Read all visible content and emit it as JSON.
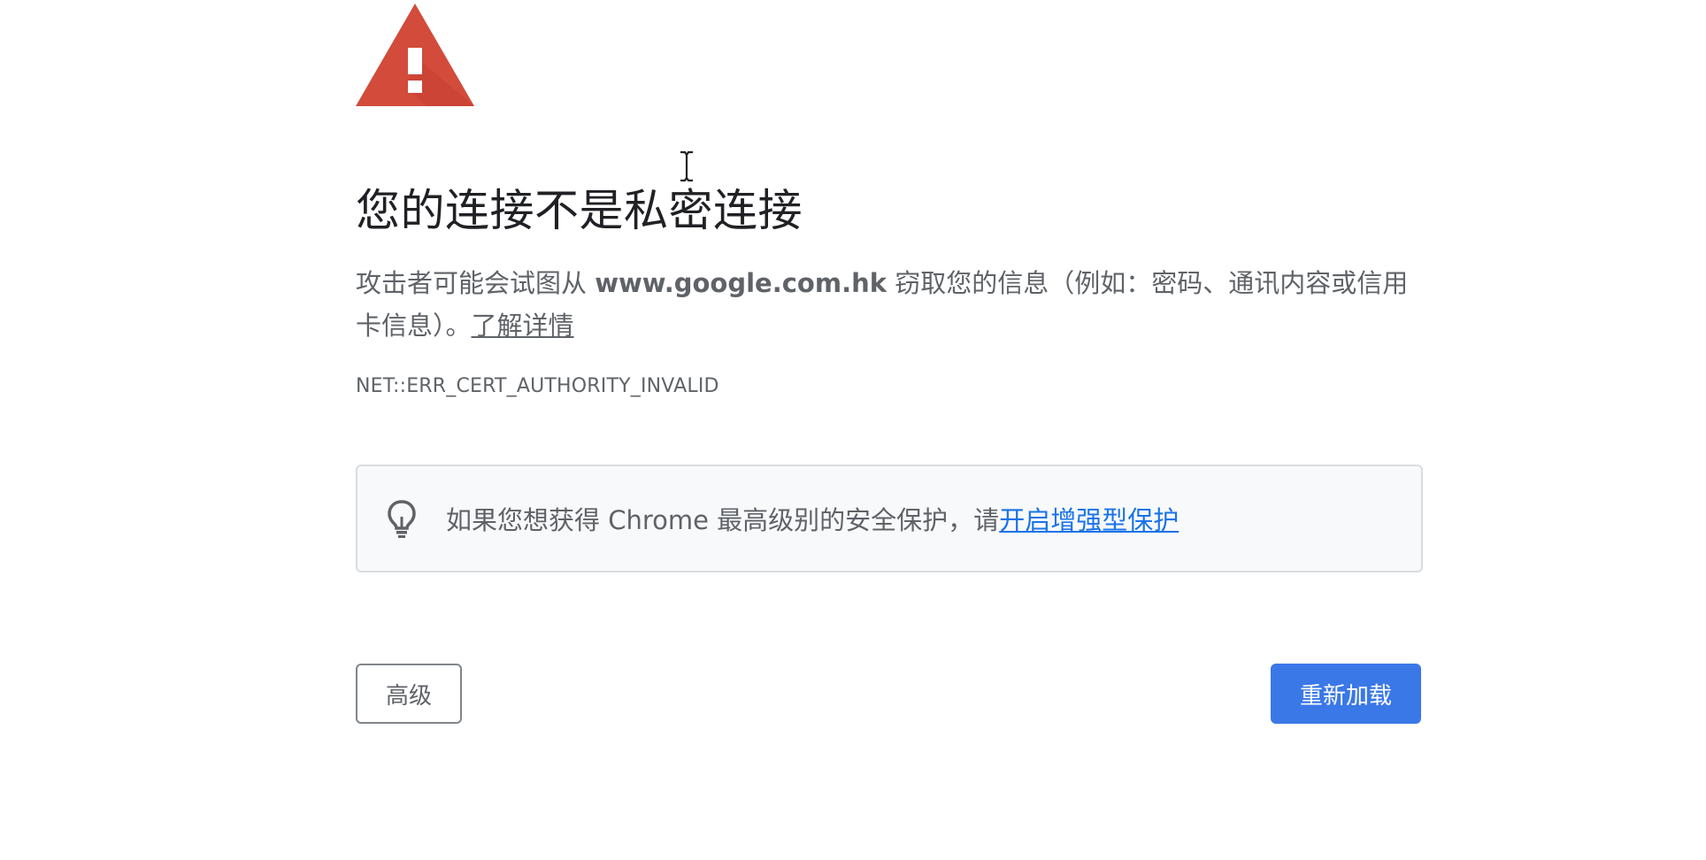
{
  "interstitial": {
    "title": "您的连接不是私密连接",
    "explanation_prefix": "攻击者可能会试图从 ",
    "domain": "www.google.com.hk",
    "explanation_suffix": " 窃取您的信息（例如：密码、通讯内容或信用卡信息）。",
    "learn_more_label": "了解详情",
    "error_code": "NET::ERR_CERT_AUTHORITY_INVALID"
  },
  "promo": {
    "icon": "lightbulb-icon",
    "text": "如果您想获得 Chrome 最高级别的安全保护，请",
    "link_label": "开启增强型保护"
  },
  "buttons": {
    "advanced_label": "高级",
    "reload_label": "重新加载"
  },
  "colors": {
    "warning_red": "#d24b3b",
    "reload_blue": "#3b78e7",
    "link_blue": "#1a73e8",
    "body_text": "#5f6368",
    "title_text": "#202124",
    "promo_background": "#f8f9fa"
  },
  "icons": {
    "warning": "warning-triangle-icon",
    "cursor": "text-cursor-icon"
  }
}
